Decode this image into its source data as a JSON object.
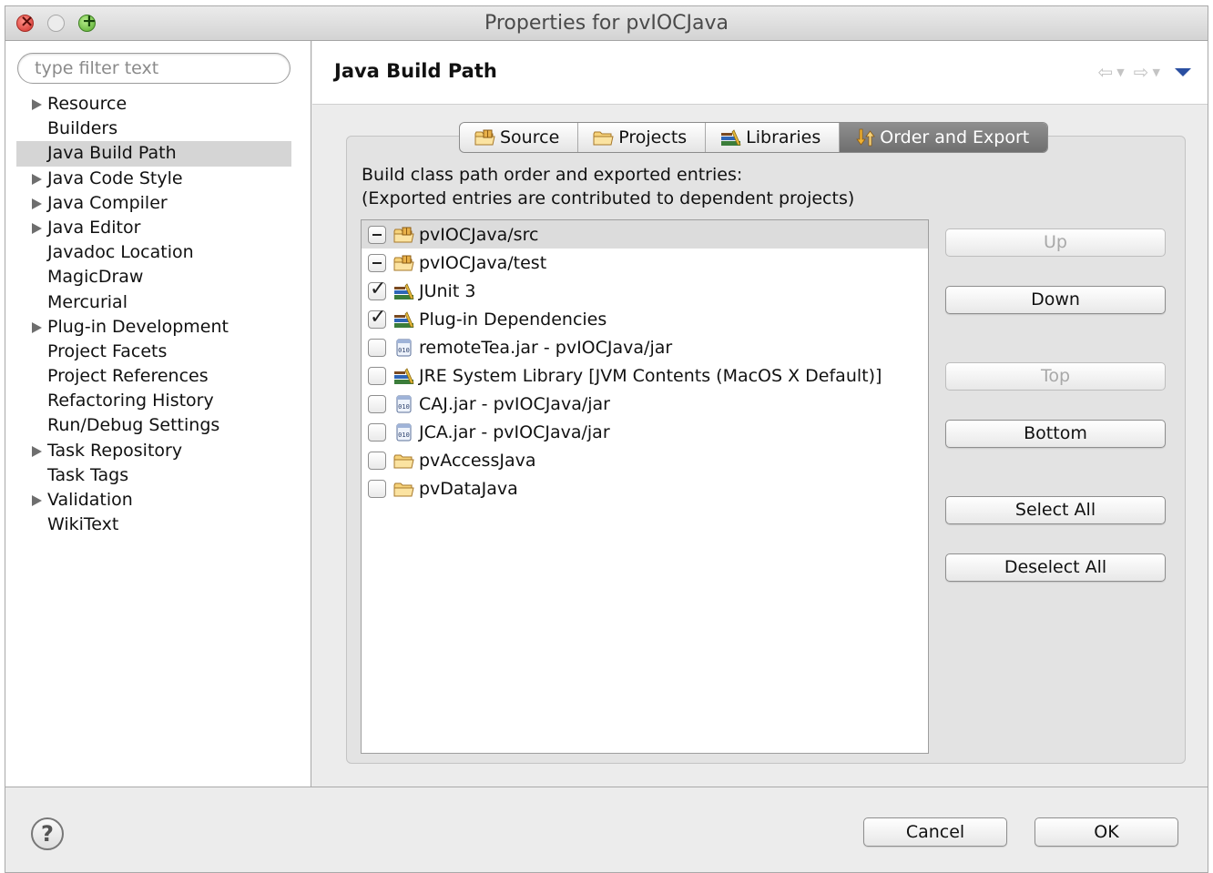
{
  "window": {
    "title": "Properties for pvIOCJava"
  },
  "filter": {
    "placeholder": "type filter text",
    "value": ""
  },
  "sidebar": {
    "items": [
      {
        "label": "Resource",
        "expandable": true,
        "selected": false
      },
      {
        "label": "Builders",
        "expandable": false,
        "selected": false
      },
      {
        "label": "Java Build Path",
        "expandable": false,
        "selected": true
      },
      {
        "label": "Java Code Style",
        "expandable": true,
        "selected": false
      },
      {
        "label": "Java Compiler",
        "expandable": true,
        "selected": false
      },
      {
        "label": "Java Editor",
        "expandable": true,
        "selected": false
      },
      {
        "label": "Javadoc Location",
        "expandable": false,
        "selected": false
      },
      {
        "label": "MagicDraw",
        "expandable": false,
        "selected": false
      },
      {
        "label": "Mercurial",
        "expandable": false,
        "selected": false
      },
      {
        "label": "Plug-in Development",
        "expandable": true,
        "selected": false
      },
      {
        "label": "Project Facets",
        "expandable": false,
        "selected": false
      },
      {
        "label": "Project References",
        "expandable": false,
        "selected": false
      },
      {
        "label": "Refactoring History",
        "expandable": false,
        "selected": false
      },
      {
        "label": "Run/Debug Settings",
        "expandable": false,
        "selected": false
      },
      {
        "label": "Task Repository",
        "expandable": true,
        "selected": false
      },
      {
        "label": "Task Tags",
        "expandable": false,
        "selected": false
      },
      {
        "label": "Validation",
        "expandable": true,
        "selected": false
      },
      {
        "label": "WikiText",
        "expandable": false,
        "selected": false
      }
    ]
  },
  "page": {
    "title": "Java Build Path"
  },
  "tabs": [
    {
      "label": "Source",
      "icon": "source-folder-icon"
    },
    {
      "label": "Projects",
      "icon": "project-folder-icon"
    },
    {
      "label": "Libraries",
      "icon": "library-icon"
    },
    {
      "label": "Order and Export",
      "icon": "order-arrows-icon",
      "active": true
    }
  ],
  "description": {
    "line1": "Build class path order and exported entries:",
    "line2": "(Exported entries are contributed to dependent projects)"
  },
  "entries": [
    {
      "label": "pvIOCJava/src",
      "state": "mixed",
      "icon": "source-folder-icon",
      "selected": true
    },
    {
      "label": "pvIOCJava/test",
      "state": "mixed",
      "icon": "source-folder-icon"
    },
    {
      "label": "JUnit 3",
      "state": "checked",
      "icon": "library-icon"
    },
    {
      "label": "Plug-in Dependencies",
      "state": "checked",
      "icon": "library-icon"
    },
    {
      "label": "remoteTea.jar - pvIOCJava/jar",
      "state": "unchecked",
      "icon": "jar-icon"
    },
    {
      "label": "JRE System Library [JVM Contents (MacOS X Default)]",
      "state": "unchecked",
      "icon": "library-icon"
    },
    {
      "label": "CAJ.jar - pvIOCJava/jar",
      "state": "unchecked",
      "icon": "jar-icon"
    },
    {
      "label": "JCA.jar - pvIOCJava/jar",
      "state": "unchecked",
      "icon": "jar-icon"
    },
    {
      "label": "pvAccessJava",
      "state": "unchecked",
      "icon": "project-folder-icon"
    },
    {
      "label": "pvDataJava",
      "state": "unchecked",
      "icon": "project-folder-icon"
    }
  ],
  "buttons": {
    "up": "Up",
    "down": "Down",
    "top": "Top",
    "bottom": "Bottom",
    "select_all": "Select All",
    "deselect_all": "Deselect All"
  },
  "footer": {
    "cancel": "Cancel",
    "ok": "OK",
    "help_glyph": "?"
  },
  "colors": {
    "selection": "#d5d5d5",
    "active_tab": "#7f7f7f",
    "folder": "#f2c15a",
    "library": "#2f7fbf"
  }
}
